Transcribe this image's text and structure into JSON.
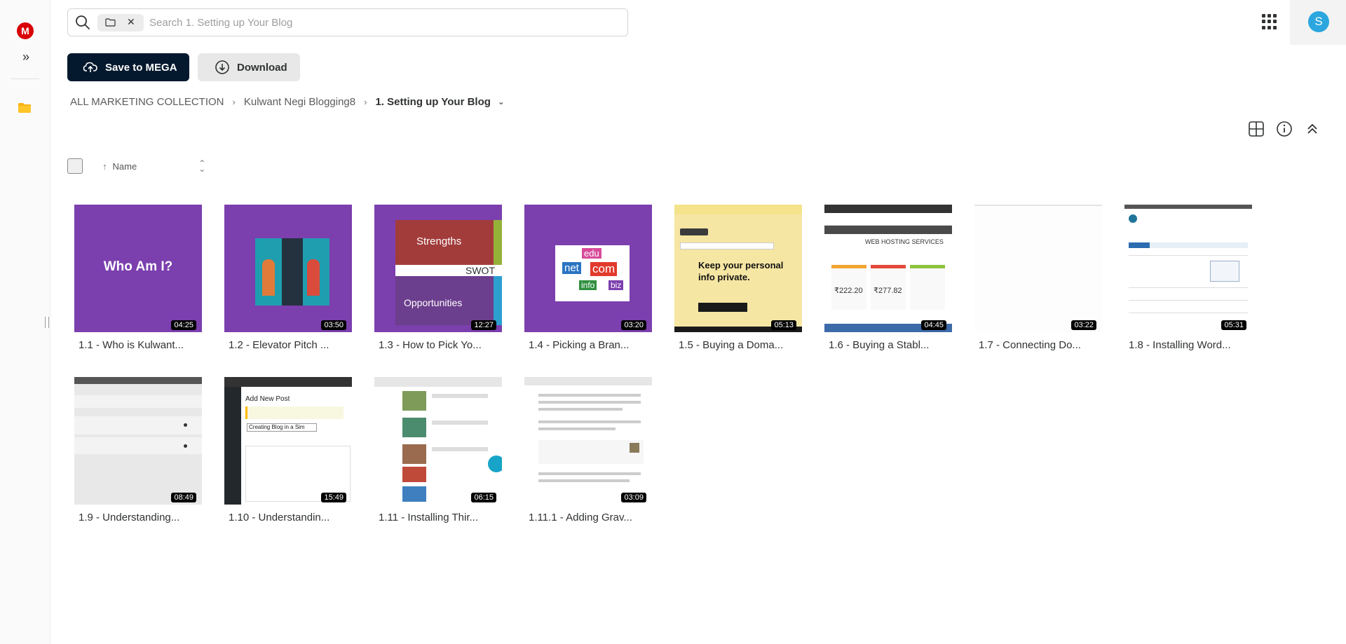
{
  "app": {
    "logo_letter": "M",
    "avatar_initial": "S",
    "colors": {
      "brand": "#d90007",
      "primary_button": "#05192e",
      "avatar": "#2ba6de",
      "thumb_purple": "#7b3fae"
    }
  },
  "search": {
    "placeholder": "Search 1. Setting up Your Blog",
    "value": ""
  },
  "toolbar": {
    "save_label": "Save to MEGA",
    "download_label": "Download"
  },
  "breadcrumb": {
    "items": [
      "ALL MARKETING COLLECTION",
      "Kulwant Negi Blogging8"
    ],
    "current": "1. Setting up Your Blog"
  },
  "sort": {
    "label": "Name"
  },
  "files": [
    {
      "label": "1.1 - Who is Kulwant...",
      "duration": "04:25",
      "thumb_text": "Who Am I?"
    },
    {
      "label": "1.2 - Elevator Pitch ...",
      "duration": "03:50"
    },
    {
      "label": "1.3 - How to Pick Yo...",
      "duration": "12:27",
      "thumb_words": [
        "Strengths",
        "SWOT",
        "Opportunities"
      ]
    },
    {
      "label": "1.4 - Picking a Bran...",
      "duration": "03:20",
      "thumb_words": [
        "edu",
        "net",
        "com",
        "info",
        "biz"
      ]
    },
    {
      "label": "1.5 - Buying a Doma...",
      "duration": "05:13",
      "thumb_text": "Keep your personal info private."
    },
    {
      "label": "1.6 - Buying a Stabl...",
      "duration": "04:45",
      "thumb_words": [
        "WEB HOSTING SERVICES",
        "₹222.20",
        "₹277.82"
      ]
    },
    {
      "label": "1.7 - Connecting Do...",
      "duration": "03:22"
    },
    {
      "label": "1.8 - Installing Word...",
      "duration": "05:31"
    },
    {
      "label": "1.9 - Understanding...",
      "duration": "08:49"
    },
    {
      "label": "1.10 - Understandin...",
      "duration": "15:49",
      "thumb_words": [
        "Add New Post",
        "Creating Blog in a Sim"
      ]
    },
    {
      "label": "1.11 - Installing Thir...",
      "duration": "06:15"
    },
    {
      "label": "1.11.1 - Adding Grav...",
      "duration": "03:09"
    }
  ]
}
